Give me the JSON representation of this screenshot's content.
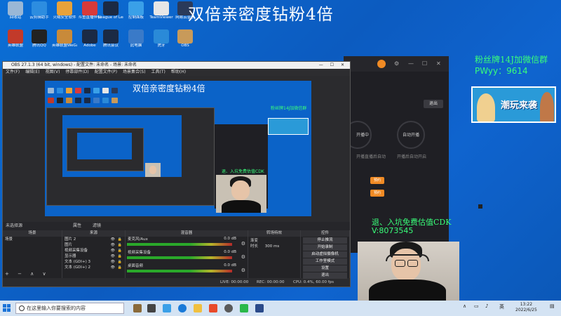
{
  "desktop": {
    "icons": [
      {
        "label": "回收站",
        "color": "#9ab7d6"
      },
      {
        "label": "云剪辑助手",
        "color": "#2d8de0"
      },
      {
        "label": "火绒安全软件",
        "color": "#e8a23a"
      },
      {
        "label": "斗鱼直播伴侣",
        "color": "#d83a3a"
      },
      {
        "label": "League of Legends",
        "color": "#1b2a44"
      },
      {
        "label": "控制面板",
        "color": "#3aa0e8"
      },
      {
        "label": "TeamViewer",
        "color": "#e6e6e6"
      },
      {
        "label": "网易云音乐",
        "color": "#2a3a5a"
      },
      {
        "label": "英雄联盟",
        "color": "#c23a2a"
      },
      {
        "label": "腾讯QQ",
        "color": "#222222"
      },
      {
        "label": "英雄联盟WeGame",
        "color": "#c88a3a"
      },
      {
        "label": "Adobe",
        "color": "#1b2a44"
      },
      {
        "label": "腾讯会议",
        "color": "#1b2a44"
      },
      {
        "label": "此电脑",
        "color": "#3a7ac8"
      },
      {
        "label": "虎牙",
        "color": "#2a8ad8"
      },
      {
        "label": "OBS",
        "color": "#c89a5a"
      }
    ]
  },
  "overlay": {
    "title": "双倍亲密度钻粉4倍",
    "fan_line1": "粉丝牌14J加微信群",
    "fan_line2": "PWyy：9614",
    "banner_text": "潮玩来袭",
    "promo_line1": "退、入坑免费估值CDK",
    "promo_line2": "V:8073545"
  },
  "right_app": {
    "exit_button": "退出",
    "label_left": "开播中",
    "label_right": "自动开播",
    "caption_left": "开播直播后自动",
    "caption_right": "开播后自动开启",
    "action1": "预约",
    "action2": "预约"
  },
  "obs": {
    "title": "OBS 27.1.3 (64 bit, windows) - 配置文件: 未命名 - 场景: 未命名",
    "menu": [
      "文件(F)",
      "编辑(E)",
      "视图(V)",
      "停靠部件(D)",
      "配置文件(P)",
      "场景集合(S)",
      "工具(T)",
      "帮助(H)"
    ],
    "source_bar": {
      "no_source": "未选择源",
      "properties": "属性",
      "filters": "滤镜"
    },
    "panels": {
      "scenes": {
        "header": "场景",
        "items": [
          "场景"
        ]
      },
      "sources": {
        "header": "来源",
        "items": [
          "图片 2",
          "图片",
          "视频采集设备",
          "显示器",
          "文本 (GDI+) 3",
          "文本 (GDI+) 2"
        ]
      },
      "mixer": {
        "header": "混音器",
        "tracks": [
          {
            "name": "麦克风/Aux",
            "db": "0.0 dB"
          },
          {
            "name": "视频采集设备",
            "db": "0.0 dB"
          },
          {
            "name": "桌面音频",
            "db": "0.0 dB"
          }
        ]
      },
      "transitions": {
        "header": "转场特效",
        "type": "渐变",
        "duration_label": "时长",
        "duration": "300 ms"
      },
      "controls": {
        "header": "控件",
        "buttons": [
          "停止推流",
          "开始录制",
          "启动虚拟摄像机",
          "工作室模式",
          "设置",
          "退出"
        ]
      }
    },
    "status": {
      "live": "LIVE: 00:00:00",
      "rec": "REC: 00:00:00",
      "cpu": "CPU: 0.4%, 60.00 fps"
    }
  },
  "taskbar": {
    "search_placeholder": "在这里输入你要搜索的内容",
    "tray_lang": "英",
    "time": "13:22",
    "date": "2022/6/25"
  }
}
